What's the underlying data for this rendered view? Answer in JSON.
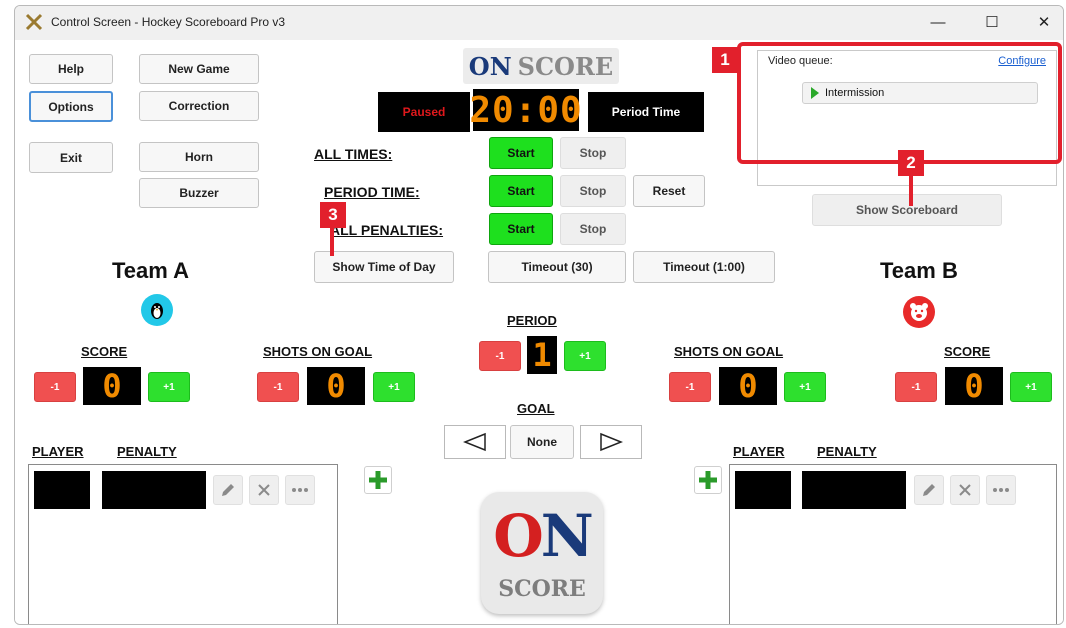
{
  "window": {
    "title": "Control Screen - Hockey Scoreboard Pro v3",
    "minimize": "—",
    "maximize": "☐",
    "close": "✕"
  },
  "left_buttons": {
    "help": "Help",
    "new_game": "New Game",
    "options": "Options",
    "correction": "Correction",
    "exit": "Exit",
    "horn": "Horn",
    "buzzer": "Buzzer"
  },
  "logo": {
    "on": "ON",
    "score": "SCORE",
    "on_color": "#1a3a7a",
    "o_color": "#d42020"
  },
  "clock": {
    "status": "Paused",
    "time": "20:00",
    "mode": "Period Time",
    "status_color": "#e0181c",
    "digit_color": "#f08a00"
  },
  "timers": {
    "all_times_label": "ALL TIMES:",
    "period_time_label": "PERIOD TIME:",
    "all_penalties_label": "ALL PENALTIES:",
    "start": "Start",
    "stop": "Stop",
    "reset": "Reset"
  },
  "actions": {
    "show_time_of_day": "Show Time of Day",
    "timeout_30": "Timeout (30)",
    "timeout_100": "Timeout (1:00)",
    "show_scoreboard": "Show Scoreboard"
  },
  "video_queue": {
    "label": "Video queue:",
    "configure": "Configure",
    "items": [
      "Intermission"
    ]
  },
  "callouts": [
    "1",
    "2",
    "3"
  ],
  "team_a": {
    "name": "Team A",
    "icon": "penguin-icon",
    "score_label": "SCORE",
    "score": "0",
    "shots_label": "SHOTS ON GOAL",
    "shots": "0",
    "player_label": "PLAYER",
    "penalty_label": "PENALTY"
  },
  "team_b": {
    "name": "Team B",
    "icon": "bear-icon",
    "score_label": "SCORE",
    "score": "0",
    "shots_label": "SHOTS ON GOAL",
    "shots": "0",
    "player_label": "PLAYER",
    "penalty_label": "PENALTY"
  },
  "period": {
    "label": "PERIOD",
    "value": "1"
  },
  "goal": {
    "label": "GOAL",
    "value": "None"
  },
  "adjust": {
    "minus": "-1",
    "plus": "+1"
  }
}
